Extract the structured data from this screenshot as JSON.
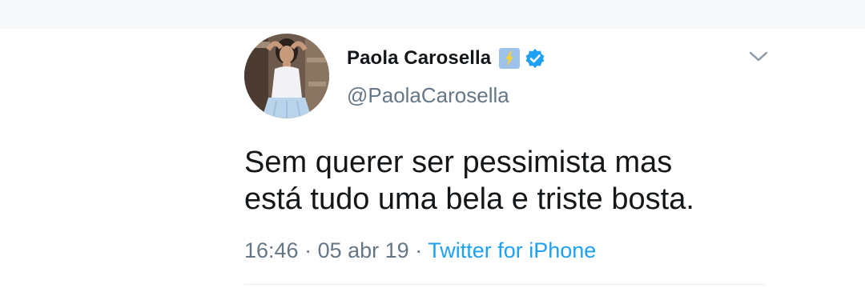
{
  "tweet": {
    "display_name": "Paola Carosella",
    "handle": "@PaolaCarosella",
    "text_lines": [
      "Sem querer ser pessimista mas",
      "está tudo uma bela e triste bosta."
    ],
    "time": "16:46",
    "separator": "·",
    "date": "05 abr 19",
    "source": "Twitter for iPhone",
    "badges": [
      "high-voltage-emoji-icon",
      "verified-badge-icon"
    ],
    "menu_icon": "chevron-down-icon"
  },
  "colors": {
    "text_primary": "#14171a",
    "text_secondary": "#657786",
    "accent": "#1da1f2",
    "top_strip": "#f7f8fa",
    "divider": "#e6ecf0"
  }
}
